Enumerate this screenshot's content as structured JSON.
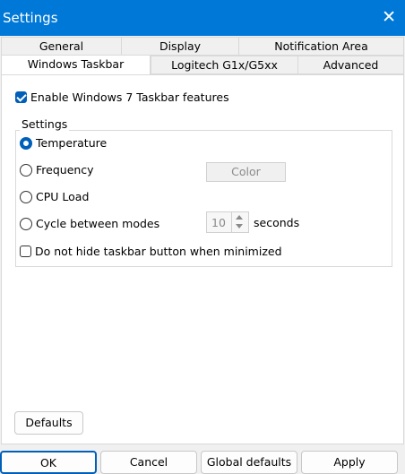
{
  "window": {
    "title": "Settings",
    "close_glyph": "✕"
  },
  "tabs": {
    "row1": [
      "General",
      "Display",
      "Notification Area"
    ],
    "row2": [
      "Windows Taskbar",
      "Logitech G1x/G5xx",
      "Advanced"
    ],
    "active": "Windows Taskbar"
  },
  "taskbar": {
    "enable_label": "Enable Windows 7 Taskbar features",
    "enable_checked": true,
    "group_label": "Settings",
    "modes": [
      {
        "label": "Temperature",
        "selected": true
      },
      {
        "label": "Frequency",
        "selected": false
      },
      {
        "label": "CPU Load",
        "selected": false
      },
      {
        "label": "Cycle between modes",
        "selected": false
      }
    ],
    "color_button": "Color",
    "cycle_value": "10",
    "cycle_unit": "seconds",
    "nohide_label": "Do not hide taskbar button when minimized",
    "nohide_checked": false,
    "defaults_button": "Defaults"
  },
  "footer": {
    "ok": "OK",
    "cancel": "Cancel",
    "global_defaults": "Global defaults",
    "apply": "Apply"
  },
  "colors": {
    "titlebar": "#0078d7",
    "accent": "#005fb8"
  }
}
